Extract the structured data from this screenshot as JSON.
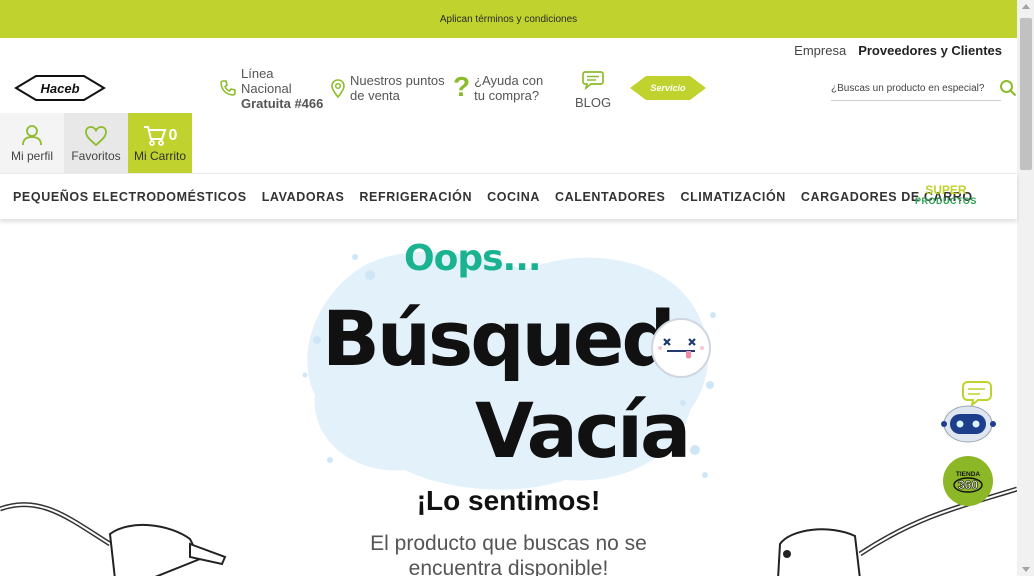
{
  "topbar": {
    "text": "Aplican términos y condiciones"
  },
  "header": {
    "util_links": [
      "Empresa",
      "Proveedores y Clientes"
    ],
    "logo_text": "Haceb",
    "line": {
      "l1": "Línea",
      "l2": "Nacional",
      "l3": "Gratuita #466"
    },
    "points": {
      "l1": "Nuestros puntos",
      "l2": "de venta"
    },
    "help": {
      "l1": "¿Ayuda con",
      "l2": "tu compra?"
    },
    "blog": "BLOG",
    "service_badge": "Servicio",
    "search_placeholder": "¿Buscas un producto en especial?",
    "profile": "Mi perfil",
    "favorites": "Favoritos",
    "cart": {
      "label": "Mi Carrito",
      "count": "0"
    }
  },
  "nav": {
    "items": [
      "PEQUEÑOS ELECTRODOMÉSTICOS",
      "LAVADORAS",
      "REFRIGERACIÓN",
      "COCINA",
      "CALENTADORES",
      "CLIMATIZACIÓN",
      "CARGADORES DE CARRO"
    ],
    "super": {
      "l1": "SUPER",
      "l2": "PRODUCTOS"
    }
  },
  "main": {
    "oops": "Oops...",
    "title_line1": "Búsqued",
    "title_line2": "Vacía",
    "sorry": "¡Lo sentimos!",
    "message_l1": "El producto que buscas no se",
    "message_l2": "encuentra disponible!"
  },
  "floating": {
    "tienda_line1": "TIENDA",
    "tienda_line2": "360"
  },
  "colors": {
    "accent": "#bfd22d",
    "teal": "#1ab291",
    "green": "#8cbc2d"
  }
}
